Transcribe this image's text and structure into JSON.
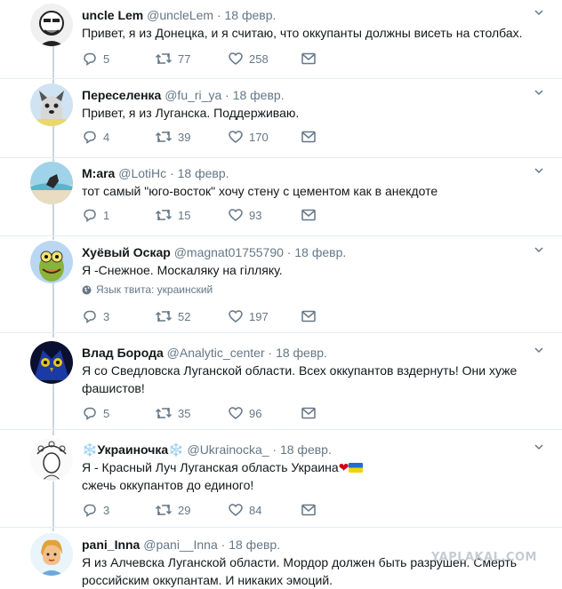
{
  "tweets": [
    {
      "name": "uncle Lem",
      "handle": "@uncleLem",
      "date": "18 февр.",
      "text": "Привет, я из Донецка, и я считаю, что оккупанты должны висеть на столбах.",
      "lang": "",
      "replies": "5",
      "retweets": "77",
      "likes": "258"
    },
    {
      "name": "Переселенка",
      "handle": "@fu_ri_ya",
      "date": "18 февр.",
      "text": "Привет, я из Луганска. Поддерживаю.",
      "lang": "",
      "replies": "4",
      "retweets": "39",
      "likes": "170"
    },
    {
      "name": "M:ara",
      "handle": "@LotiHc",
      "date": "18 февр.",
      "text": "тот самый \"юго-восток\" хочу стену с цементом как в анекдоте",
      "lang": "",
      "replies": "1",
      "retweets": "15",
      "likes": "93"
    },
    {
      "name": "Хуёвый Оскар",
      "handle": "@magnat01755790",
      "date": "18 февр.",
      "text": "Я -Снежное. Москаляку на гілляку.",
      "lang": "Язык твита: украинский",
      "replies": "3",
      "retweets": "52",
      "likes": "197"
    },
    {
      "name": "Влад Борода",
      "handle": "@Analytic_center",
      "date": "18 февр.",
      "text_line1": "Я со Сведловска Луганской области. Всех оккупантов вздернуть! Они хуже",
      "text_line2": "фашистов!",
      "lang": "",
      "replies": "5",
      "retweets": "35",
      "likes": "96"
    },
    {
      "name_prefix": "❄️",
      "name": "Украиночка",
      "name_suffix": "❄️",
      "handle": "@Ukrainocka_",
      "date": "18 февр.",
      "text_line1": "Я - Красный Луч Луганская область Украина",
      "text_line1_emoji": "❤",
      "text_line2": "сжечь оккупантов до единого!",
      "lang": "",
      "replies": "3",
      "retweets": "29",
      "likes": "84"
    },
    {
      "name": "pani_Inna",
      "handle": "@pani__Inna",
      "date": "18 февр.",
      "text_line1": "Я из Алчевска Луганской области. Мордор должен быть разрушен. Смерть",
      "text_line2": "российским оккупантам. И никаких эмоций.",
      "lang": "",
      "replies": "",
      "retweets": "",
      "likes": ""
    }
  ],
  "separator_dot": "·",
  "watermark": "YAPLAKAL.COM",
  "colors": {
    "text": "#14171a",
    "meta": "#657786",
    "divider": "#e6ecf0",
    "thread": "#ccd6dd"
  }
}
